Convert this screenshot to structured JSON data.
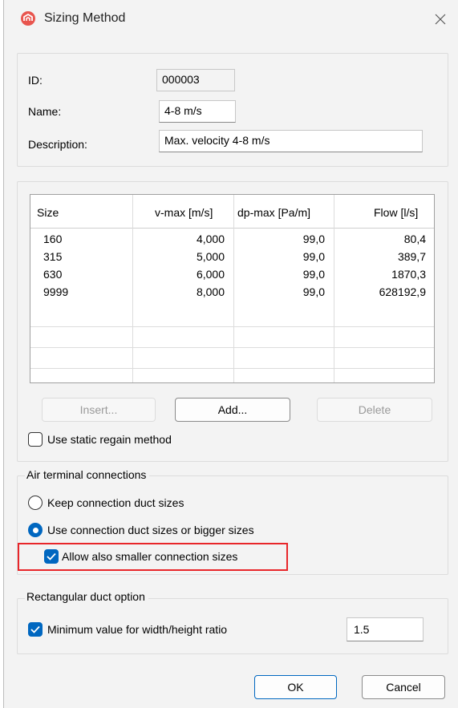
{
  "window": {
    "title": "Sizing Method",
    "accent": "#0067c0",
    "highlight_color": "#e8262a"
  },
  "fields": {
    "id_label": "ID:",
    "id_value": "000003",
    "name_label": "Name:",
    "name_value": "4-8 m/s",
    "description_label": "Description:",
    "description_value": "Max. velocity 4-8 m/s"
  },
  "table": {
    "columns": [
      "Size",
      "v-max [m/s]",
      "dp-max [Pa/m]",
      "Flow [l/s]"
    ],
    "rows": [
      [
        "160",
        "4,000",
        "99,0",
        "80,4"
      ],
      [
        "315",
        "5,000",
        "99,0",
        "389,7"
      ],
      [
        "630",
        "6,000",
        "99,0",
        "1870,3"
      ],
      [
        "9999",
        "8,000",
        "99,0",
        "628192,9"
      ]
    ]
  },
  "buttons": {
    "insert": "Insert...",
    "add": "Add...",
    "delete": "Delete",
    "ok": "OK",
    "cancel": "Cancel"
  },
  "static_regain": {
    "label": "Use static regain method",
    "checked": false
  },
  "air_terminal": {
    "title": "Air terminal connections",
    "keep_label": "Keep connection duct sizes",
    "bigger_label": "Use connection duct sizes or bigger sizes",
    "selected": "bigger",
    "allow_smaller_label": "Allow also smaller connection sizes",
    "allow_smaller_checked": true
  },
  "rect_duct": {
    "title": "Rectangular duct option",
    "min_ratio_label": "Minimum value for width/height ratio",
    "min_ratio_checked": true,
    "min_ratio_value": "1.5"
  }
}
